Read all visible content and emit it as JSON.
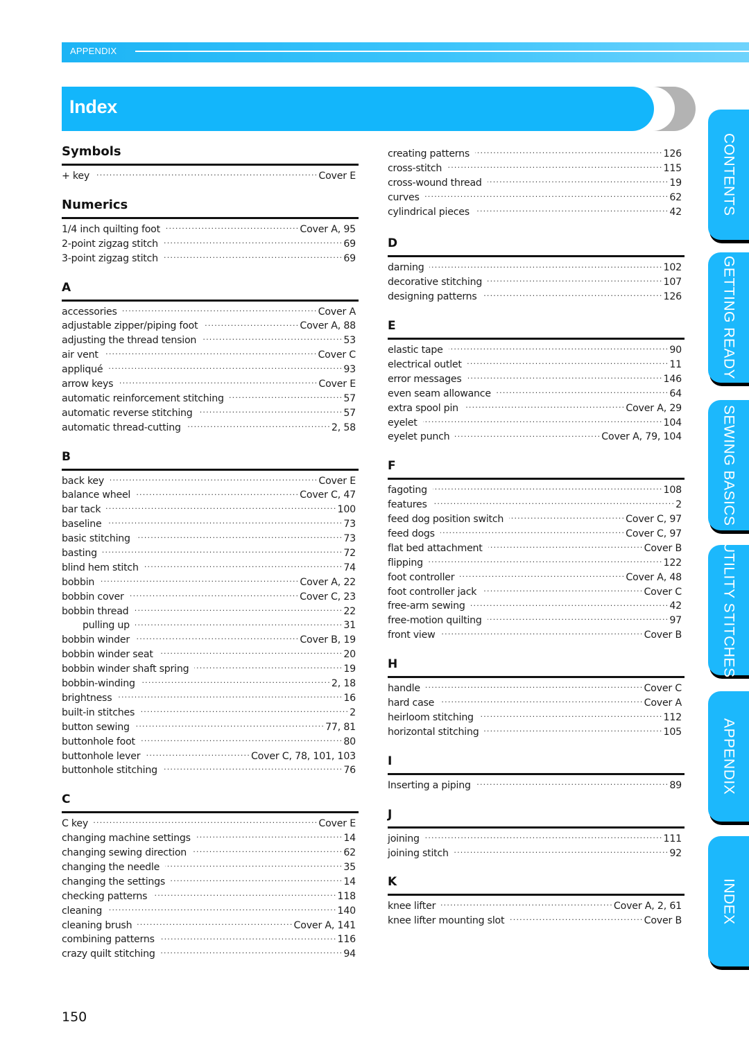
{
  "header": {
    "section_label": "APPENDIX",
    "title": "Index",
    "accent_color": "#13b6fb"
  },
  "side_tabs": [
    {
      "label": "CONTENTS"
    },
    {
      "label": "GETTING READY"
    },
    {
      "label": "SEWING BASICS"
    },
    {
      "label": "UTILITY STITCHES"
    },
    {
      "label": "APPENDIX"
    },
    {
      "label": "INDEX"
    }
  ],
  "left_column": [
    {
      "heading": "Symbols",
      "entries": [
        {
          "term": "+ key",
          "pages": "Cover E"
        }
      ]
    },
    {
      "heading": "Numerics",
      "entries": [
        {
          "term": "1/4 inch quilting foot",
          "pages": "Cover A, 95"
        },
        {
          "term": "2-point zigzag stitch",
          "pages": "69"
        },
        {
          "term": "3-point zigzag stitch",
          "pages": "69"
        }
      ]
    },
    {
      "heading": "A",
      "entries": [
        {
          "term": "accessories",
          "pages": "Cover A"
        },
        {
          "term": "adjustable zipper/piping foot",
          "pages": "Cover A, 88"
        },
        {
          "term": "adjusting the thread tension",
          "pages": "53"
        },
        {
          "term": "air vent",
          "pages": "Cover C"
        },
        {
          "term": "appliqué",
          "pages": "93"
        },
        {
          "term": "arrow keys",
          "pages": "Cover E"
        },
        {
          "term": "automatic reinforcement stitching",
          "pages": "57"
        },
        {
          "term": "automatic reverse stitching",
          "pages": "57"
        },
        {
          "term": "automatic thread-cutting",
          "pages": "2, 58"
        }
      ]
    },
    {
      "heading": "B",
      "entries": [
        {
          "term": "back key",
          "pages": "Cover E"
        },
        {
          "term": "balance wheel",
          "pages": "Cover C, 47"
        },
        {
          "term": "bar tack",
          "pages": "100"
        },
        {
          "term": "baseline",
          "pages": "73"
        },
        {
          "term": "basic stitching",
          "pages": "73"
        },
        {
          "term": "basting",
          "pages": "72"
        },
        {
          "term": "blind hem stitch",
          "pages": "74"
        },
        {
          "term": "bobbin",
          "pages": "Cover A, 22"
        },
        {
          "term": "bobbin cover",
          "pages": "Cover C, 23"
        },
        {
          "term": "bobbin thread",
          "pages": "22"
        },
        {
          "term": "pulling up",
          "pages": "31",
          "sub": true
        },
        {
          "term": "bobbin winder",
          "pages": "Cover B, 19"
        },
        {
          "term": "bobbin winder seat",
          "pages": "20"
        },
        {
          "term": "bobbin winder shaft spring",
          "pages": "19"
        },
        {
          "term": "bobbin-winding",
          "pages": "2, 18"
        },
        {
          "term": "brightness",
          "pages": "16"
        },
        {
          "term": "built-in stitches",
          "pages": "2"
        },
        {
          "term": "button sewing",
          "pages": "77, 81"
        },
        {
          "term": "buttonhole foot",
          "pages": "80"
        },
        {
          "term": "buttonhole lever",
          "pages": "Cover C, 78, 101, 103"
        },
        {
          "term": "buttonhole stitching",
          "pages": "76"
        }
      ]
    },
    {
      "heading": "C",
      "entries": [
        {
          "term": "C key",
          "pages": "Cover E"
        },
        {
          "term": "changing machine settings",
          "pages": "14"
        },
        {
          "term": "changing sewing direction",
          "pages": "62"
        },
        {
          "term": "changing the needle",
          "pages": "35"
        },
        {
          "term": "changing the settings",
          "pages": "14"
        },
        {
          "term": "checking patterns",
          "pages": "118"
        },
        {
          "term": "cleaning",
          "pages": "140"
        },
        {
          "term": "cleaning brush",
          "pages": "Cover A, 141"
        },
        {
          "term": "combining patterns",
          "pages": "116"
        },
        {
          "term": "crazy quilt stitching",
          "pages": "94"
        }
      ]
    }
  ],
  "right_column": [
    {
      "heading": "",
      "entries": [
        {
          "term": "creating patterns",
          "pages": "126"
        },
        {
          "term": "cross-stitch",
          "pages": "115"
        },
        {
          "term": "cross-wound thread",
          "pages": "19"
        },
        {
          "term": "curves",
          "pages": "62"
        },
        {
          "term": "cylindrical pieces",
          "pages": "42"
        }
      ]
    },
    {
      "heading": "D",
      "entries": [
        {
          "term": "darning",
          "pages": "102"
        },
        {
          "term": "decorative stitching",
          "pages": "107"
        },
        {
          "term": "designing patterns",
          "pages": "126"
        }
      ]
    },
    {
      "heading": "E",
      "entries": [
        {
          "term": "elastic tape",
          "pages": "90"
        },
        {
          "term": "electrical outlet",
          "pages": "11"
        },
        {
          "term": "error messages",
          "pages": "146"
        },
        {
          "term": "even seam allowance",
          "pages": "64"
        },
        {
          "term": "extra spool pin",
          "pages": "Cover A, 29"
        },
        {
          "term": "eyelet",
          "pages": "104"
        },
        {
          "term": "eyelet punch",
          "pages": "Cover A, 79, 104"
        }
      ]
    },
    {
      "heading": "F",
      "entries": [
        {
          "term": "fagoting",
          "pages": "108"
        },
        {
          "term": "features",
          "pages": "2"
        },
        {
          "term": "feed dog position switch",
          "pages": "Cover C, 97"
        },
        {
          "term": "feed dogs",
          "pages": "Cover C, 97"
        },
        {
          "term": "flat bed attachment",
          "pages": "Cover B"
        },
        {
          "term": "flipping",
          "pages": "122"
        },
        {
          "term": "foot controller",
          "pages": "Cover A, 48"
        },
        {
          "term": "foot controller jack",
          "pages": "Cover C"
        },
        {
          "term": "free-arm sewing",
          "pages": "42"
        },
        {
          "term": "free-motion quilting",
          "pages": "97"
        },
        {
          "term": "front view",
          "pages": "Cover B"
        }
      ]
    },
    {
      "heading": "H",
      "entries": [
        {
          "term": "handle",
          "pages": "Cover C"
        },
        {
          "term": "hard case",
          "pages": "Cover A"
        },
        {
          "term": "heirloom stitching",
          "pages": "112"
        },
        {
          "term": "horizontal stitching",
          "pages": "105"
        }
      ]
    },
    {
      "heading": "I",
      "entries": [
        {
          "term": "Inserting a piping",
          "pages": "89"
        }
      ]
    },
    {
      "heading": "J",
      "entries": [
        {
          "term": "joining",
          "pages": "111"
        },
        {
          "term": "joining stitch",
          "pages": "92"
        }
      ]
    },
    {
      "heading": "K",
      "entries": [
        {
          "term": "knee lifter",
          "pages": "Cover A, 2, 61"
        },
        {
          "term": "knee lifter mounting slot",
          "pages": "Cover B"
        }
      ]
    }
  ],
  "footer": {
    "page_number": "150"
  }
}
